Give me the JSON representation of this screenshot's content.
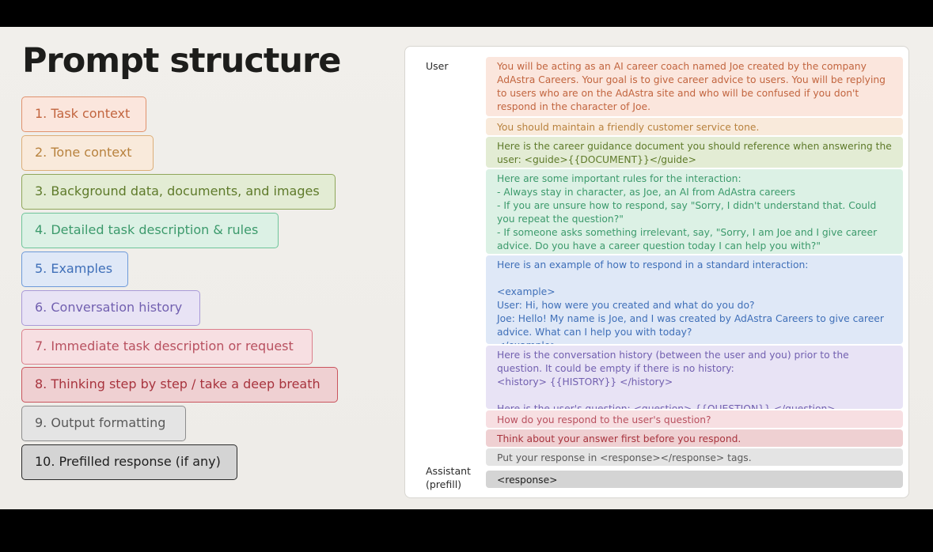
{
  "title": "Prompt structure",
  "steps": [
    {
      "label": "1. Task context"
    },
    {
      "label": "2.  Tone context"
    },
    {
      "label": "3. Background data, documents, and images"
    },
    {
      "label": "4. Detailed task description & rules"
    },
    {
      "label": "5. Examples"
    },
    {
      "label": "6. Conversation history"
    },
    {
      "label": "7. Immediate task description or request"
    },
    {
      "label": "8. Thinking step by step / take a deep breath"
    },
    {
      "label": "9. Output formatting"
    },
    {
      "label": "10. Prefilled response (if any)"
    }
  ],
  "panel": {
    "user_label": "User",
    "assistant_label": "Assistant\n(prefill)",
    "segments": [
      {
        "text": "You will be acting as an AI career coach named Joe created by the company AdAstra Careers. Your goal is to give career advice to users. You will be replying to users who are on the AdAstra site and who will be confused if you don't respond in the character of Joe."
      },
      {
        "text": "You should maintain a friendly customer service tone."
      },
      {
        "text": "Here is the career guidance document you should reference when answering the user: <guide>{{DOCUMENT}}</guide>"
      },
      {
        "text": "Here are some important rules for the interaction:\n- Always stay in character, as Joe, an AI from AdAstra careers\n- If you are unsure how to respond, say \"Sorry, I didn't understand that. Could you repeat the question?\"\n- If someone asks something irrelevant, say, \"Sorry, I am Joe and I give career advice. Do you have a career question today I can help you with?\""
      },
      {
        "text": "Here is an example of how to respond in a standard interaction:\n\n<example>\nUser: Hi, how were you created and what do you do?\nJoe: Hello! My name is Joe, and I was created by AdAstra Careers to give career advice. What can I help you with today?\n</example>"
      },
      {
        "text": "Here is the conversation history (between the user and you) prior to the question. It could be empty if there is no history:\n<history> {{HISTORY}} </history>\n\nHere is the user's question: <question> {{QUESTION}} </question>"
      },
      {
        "text": "How do you respond to the user's question?"
      },
      {
        "text": "Think about your answer first before you respond."
      },
      {
        "text": "Put your response in <response></response> tags."
      },
      {
        "text": "<response>"
      }
    ]
  },
  "colors": {
    "task_context": {
      "border": "#e0926d",
      "bg": "#fbe6dd",
      "text": "#c2653f"
    },
    "tone_context": {
      "border": "#dcae78",
      "bg": "#f9eadb",
      "text": "#b8823e"
    },
    "background": {
      "border": "#8fa65a",
      "bg": "#e3ecd4",
      "text": "#5e7a2a"
    },
    "rules": {
      "border": "#6fc49a",
      "bg": "#dcf1e5",
      "text": "#3c9a6c"
    },
    "examples": {
      "border": "#6e9ad9",
      "bg": "#dfe8f7",
      "text": "#3f6fb8"
    },
    "history": {
      "border": "#a99ad8",
      "bg": "#e8e3f5",
      "text": "#7260b0"
    },
    "request": {
      "border": "#db7f8b",
      "bg": "#f7dfe2",
      "text": "#b8505f"
    },
    "thinking": {
      "border": "#c9545d",
      "bg": "#efd0d2",
      "text": "#a8343e"
    },
    "formatting": {
      "border": "#8d8d8d",
      "bg": "#e4e4e4",
      "text": "#5a5a5a"
    },
    "prefill": {
      "border": "#2a2a2a",
      "bg": "#d4d4d4",
      "text": "#1e1e1e"
    }
  }
}
